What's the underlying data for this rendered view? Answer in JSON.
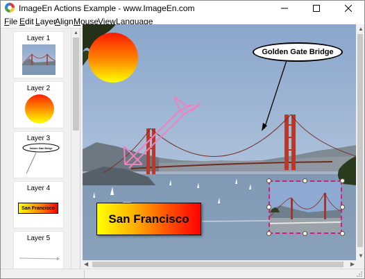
{
  "window": {
    "title": "ImageEn Actions Example - www.ImageEn.com",
    "controls": {
      "minimize": "minimize-icon",
      "maximize": "maximize-icon",
      "close": "close-icon"
    }
  },
  "menu": [
    {
      "label": "File",
      "key": "F",
      "rest": "ile"
    },
    {
      "label": "Edit",
      "key": "E",
      "rest": "dit"
    },
    {
      "label": "Layer",
      "key": "L",
      "rest": "ayer"
    },
    {
      "label": "Align",
      "key": "A",
      "rest": "lign"
    },
    {
      "label": "Mouse",
      "key": "M",
      "rest": "ouse"
    },
    {
      "label": "View",
      "key": "V",
      "rest": "iew"
    },
    {
      "label": "Language",
      "key": "L",
      "rest": "anguage"
    }
  ],
  "layers": [
    {
      "label": "Layer 1",
      "thumbnail": "photo"
    },
    {
      "label": "Layer 2",
      "thumbnail": "gradient-circle"
    },
    {
      "label": "Layer 3",
      "thumbnail": "callout",
      "thumb_text": "Golden Gate Bridge"
    },
    {
      "label": "Layer 4",
      "thumbnail": "text-box",
      "thumb_text": "San Francisco"
    },
    {
      "label": "Layer 5",
      "thumbnail": "line"
    }
  ],
  "canvas": {
    "callout_text": "Golden Gate Bridge",
    "text_layer": "San Francisco",
    "colors": {
      "selection": "#e0177a",
      "arrow": "#f080c0",
      "sky": "#93aed0",
      "bridge": "#b8382a"
    }
  },
  "status": {
    "left": "",
    "right": ""
  }
}
